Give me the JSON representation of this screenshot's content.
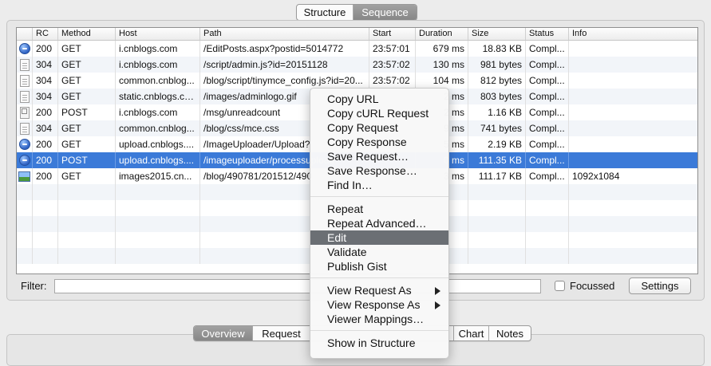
{
  "view_switch": {
    "structure": "Structure",
    "sequence": "Sequence",
    "active": "sequence"
  },
  "table": {
    "columns": [
      "RC",
      "Method",
      "Host",
      "Path",
      "Start",
      "Duration",
      "Size",
      "Status",
      "Info"
    ],
    "rows": [
      {
        "icon": "globe-icon",
        "rc": "200",
        "method": "GET",
        "host": "i.cnblogs.com",
        "path": "/EditPosts.aspx?postid=5014772",
        "start": "23:57:01",
        "duration": "679 ms",
        "size": "18.83 KB",
        "status": "Compl...",
        "info": ""
      },
      {
        "icon": "document-icon",
        "rc": "304",
        "method": "GET",
        "host": "i.cnblogs.com",
        "path": "/script/admin.js?id=20151128",
        "start": "23:57:02",
        "duration": "130 ms",
        "size": "981 bytes",
        "status": "Compl...",
        "info": ""
      },
      {
        "icon": "document-icon",
        "rc": "304",
        "method": "GET",
        "host": "common.cnblog...",
        "path": "/blog/script/tinymce_config.js?id=20...",
        "start": "23:57:02",
        "duration": "104 ms",
        "size": "812 bytes",
        "status": "Compl...",
        "info": ""
      },
      {
        "icon": "document-icon",
        "rc": "304",
        "method": "GET",
        "host": "static.cnblogs.co...",
        "path": "/images/adminlogo.gif",
        "start": "",
        "duration": "2 ms",
        "size": "803 bytes",
        "status": "Compl...",
        "info": ""
      },
      {
        "icon": "text-document-icon",
        "rc": "200",
        "method": "POST",
        "host": "i.cnblogs.com",
        "path": "/msg/unreadcount",
        "start": "",
        "duration": "2 ms",
        "size": "1.16 KB",
        "status": "Compl...",
        "info": ""
      },
      {
        "icon": "document-icon",
        "rc": "304",
        "method": "GET",
        "host": "common.cnblog...",
        "path": "/blog/css/mce.css",
        "start": "",
        "duration": "9 ms",
        "size": "741 bytes",
        "status": "Compl...",
        "info": ""
      },
      {
        "icon": "globe-icon",
        "rc": "200",
        "method": "GET",
        "host": "upload.cnblogs....",
        "path": "/ImageUploader/Upload?",
        "start": "",
        "duration": "5 ms",
        "size": "2.19 KB",
        "status": "Compl...",
        "info": ""
      },
      {
        "icon": "globe-icon",
        "rc": "200",
        "method": "POST",
        "host": "upload.cnblogs....",
        "path": "/imageuploader/processupload",
        "start": "",
        "duration": "0 ms",
        "size": "111.35 KB",
        "status": "Compl...",
        "info": "",
        "selected": true
      },
      {
        "icon": "image-icon",
        "rc": "200",
        "method": "GET",
        "host": "images2015.cn...",
        "path": "/blog/490781/201512/490",
        "start": "",
        "duration": "3 ms",
        "size": "111.17 KB",
        "status": "Compl...",
        "info": "1092x1084"
      }
    ]
  },
  "filter": {
    "label": "Filter:",
    "value": "",
    "focussed_label": "Focussed",
    "settings_label": "Settings"
  },
  "bottom_tabs": [
    "Overview",
    "Request",
    "Chart",
    "Notes"
  ],
  "context_menu": {
    "groups": [
      [
        "Copy URL",
        "Copy cURL Request",
        "Copy Request",
        "Copy Response",
        "Save Request…",
        "Save Response…",
        "Find In…"
      ],
      [
        "Repeat",
        "Repeat Advanced…",
        "Edit",
        "Validate",
        "Publish Gist"
      ],
      [
        "View Request As",
        "View Response As",
        "Viewer Mappings…"
      ],
      [
        "Show in Structure"
      ]
    ],
    "highlighted": "Edit",
    "submenu_items": [
      "View Request As",
      "View Response As"
    ]
  }
}
